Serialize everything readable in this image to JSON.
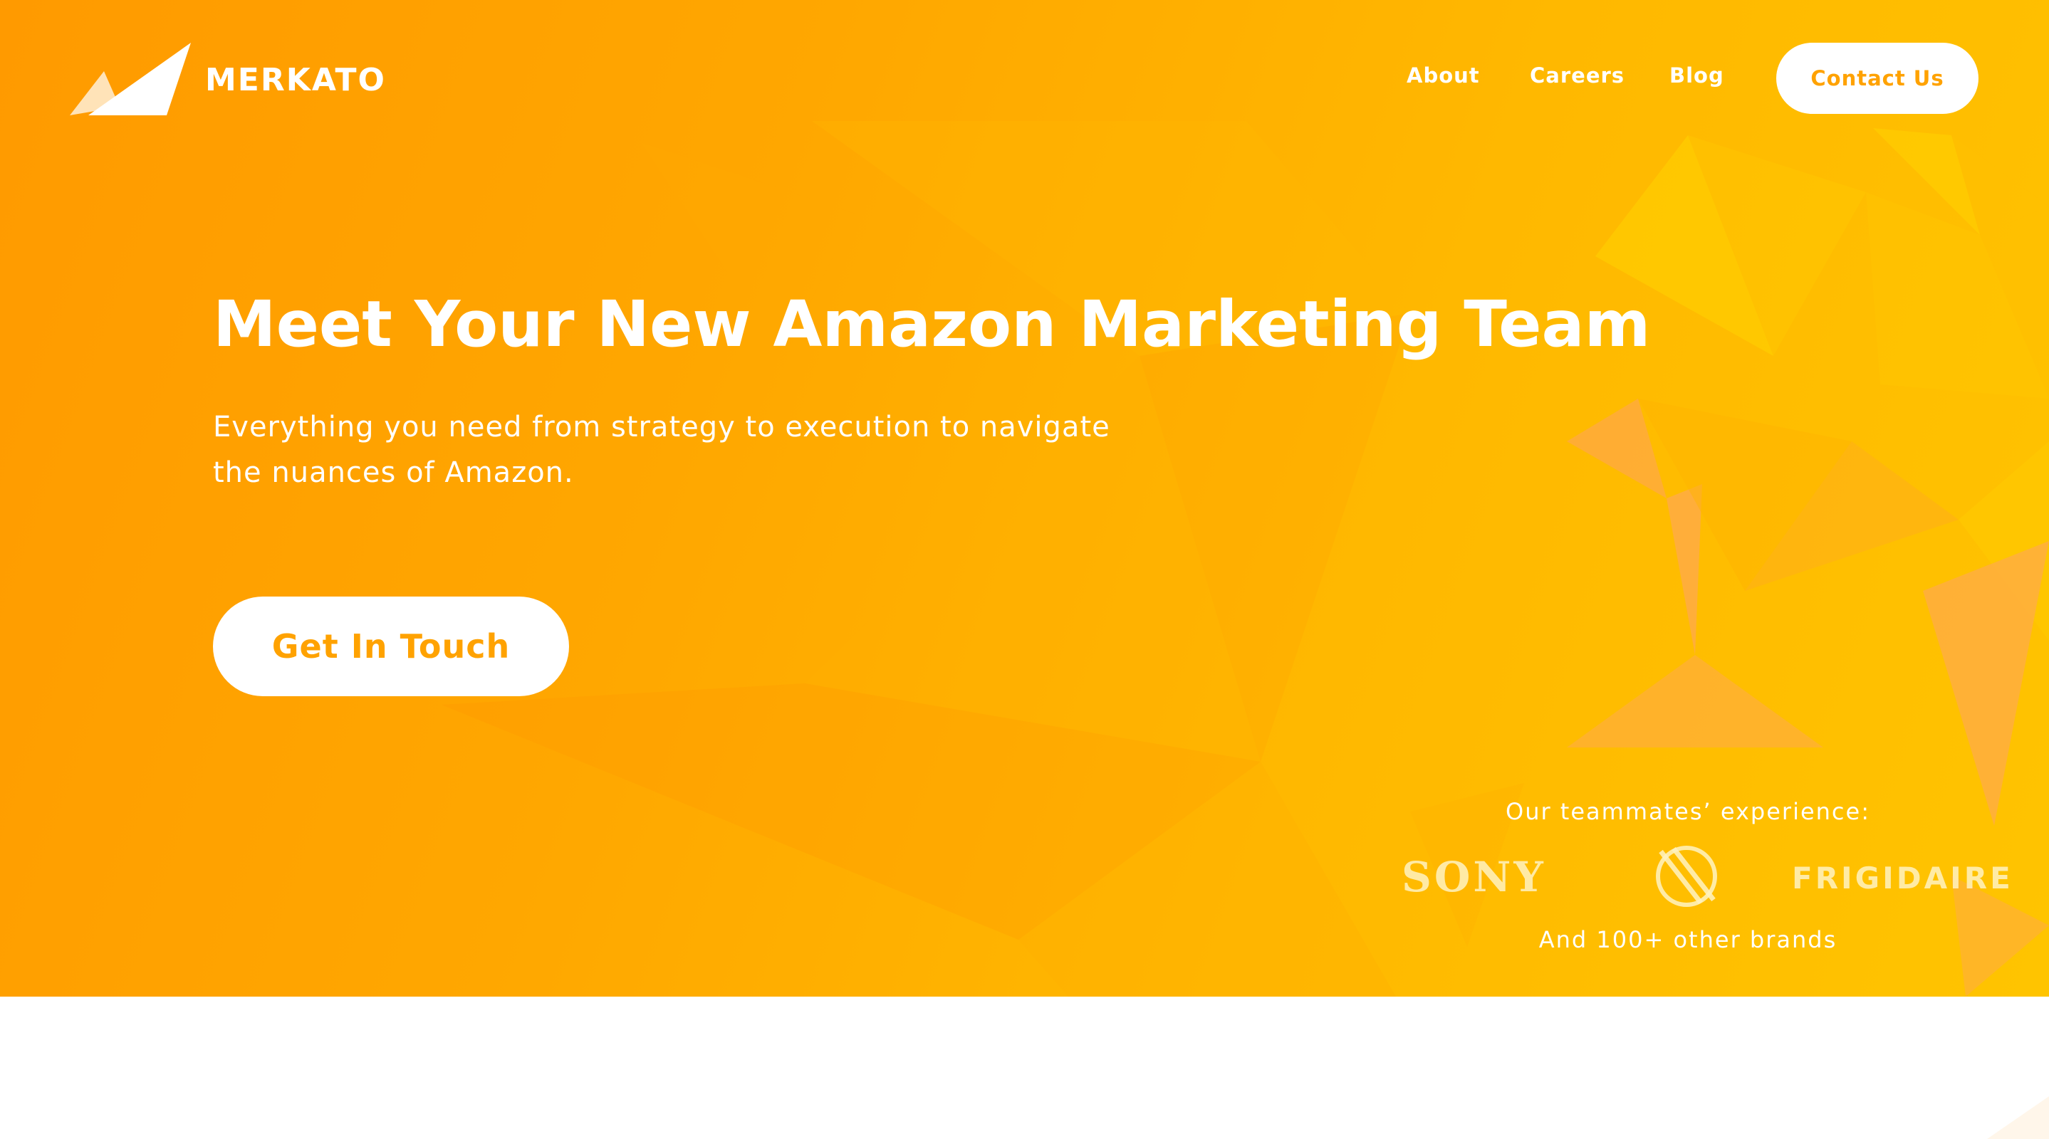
{
  "header": {
    "brand_name": "MERKATO",
    "logo_icon": "mountain-peaks-logo",
    "nav": [
      {
        "label": "About"
      },
      {
        "label": "Careers"
      },
      {
        "label": "Blog"
      }
    ],
    "contact_label": "Contact Us"
  },
  "hero": {
    "headline": "Meet Your New Amazon Marketing Team",
    "subheadline": "Everything you need from strategy to execution to navigate the nuances of Amazon.",
    "cta_label": "Get In Touch",
    "brands_caption": "Our teammates’ experience:",
    "brands": [
      {
        "name": "SONY"
      },
      {
        "name": "slashed-circle-brand-mark"
      },
      {
        "name": "FRIGIDAIRE"
      }
    ],
    "brands_footnote": "And 100+ other brands"
  },
  "colors": {
    "primary_orange": "#ff9a00",
    "accent_yellow": "#ffc400",
    "button_text": "#ffa200",
    "white": "#ffffff"
  }
}
